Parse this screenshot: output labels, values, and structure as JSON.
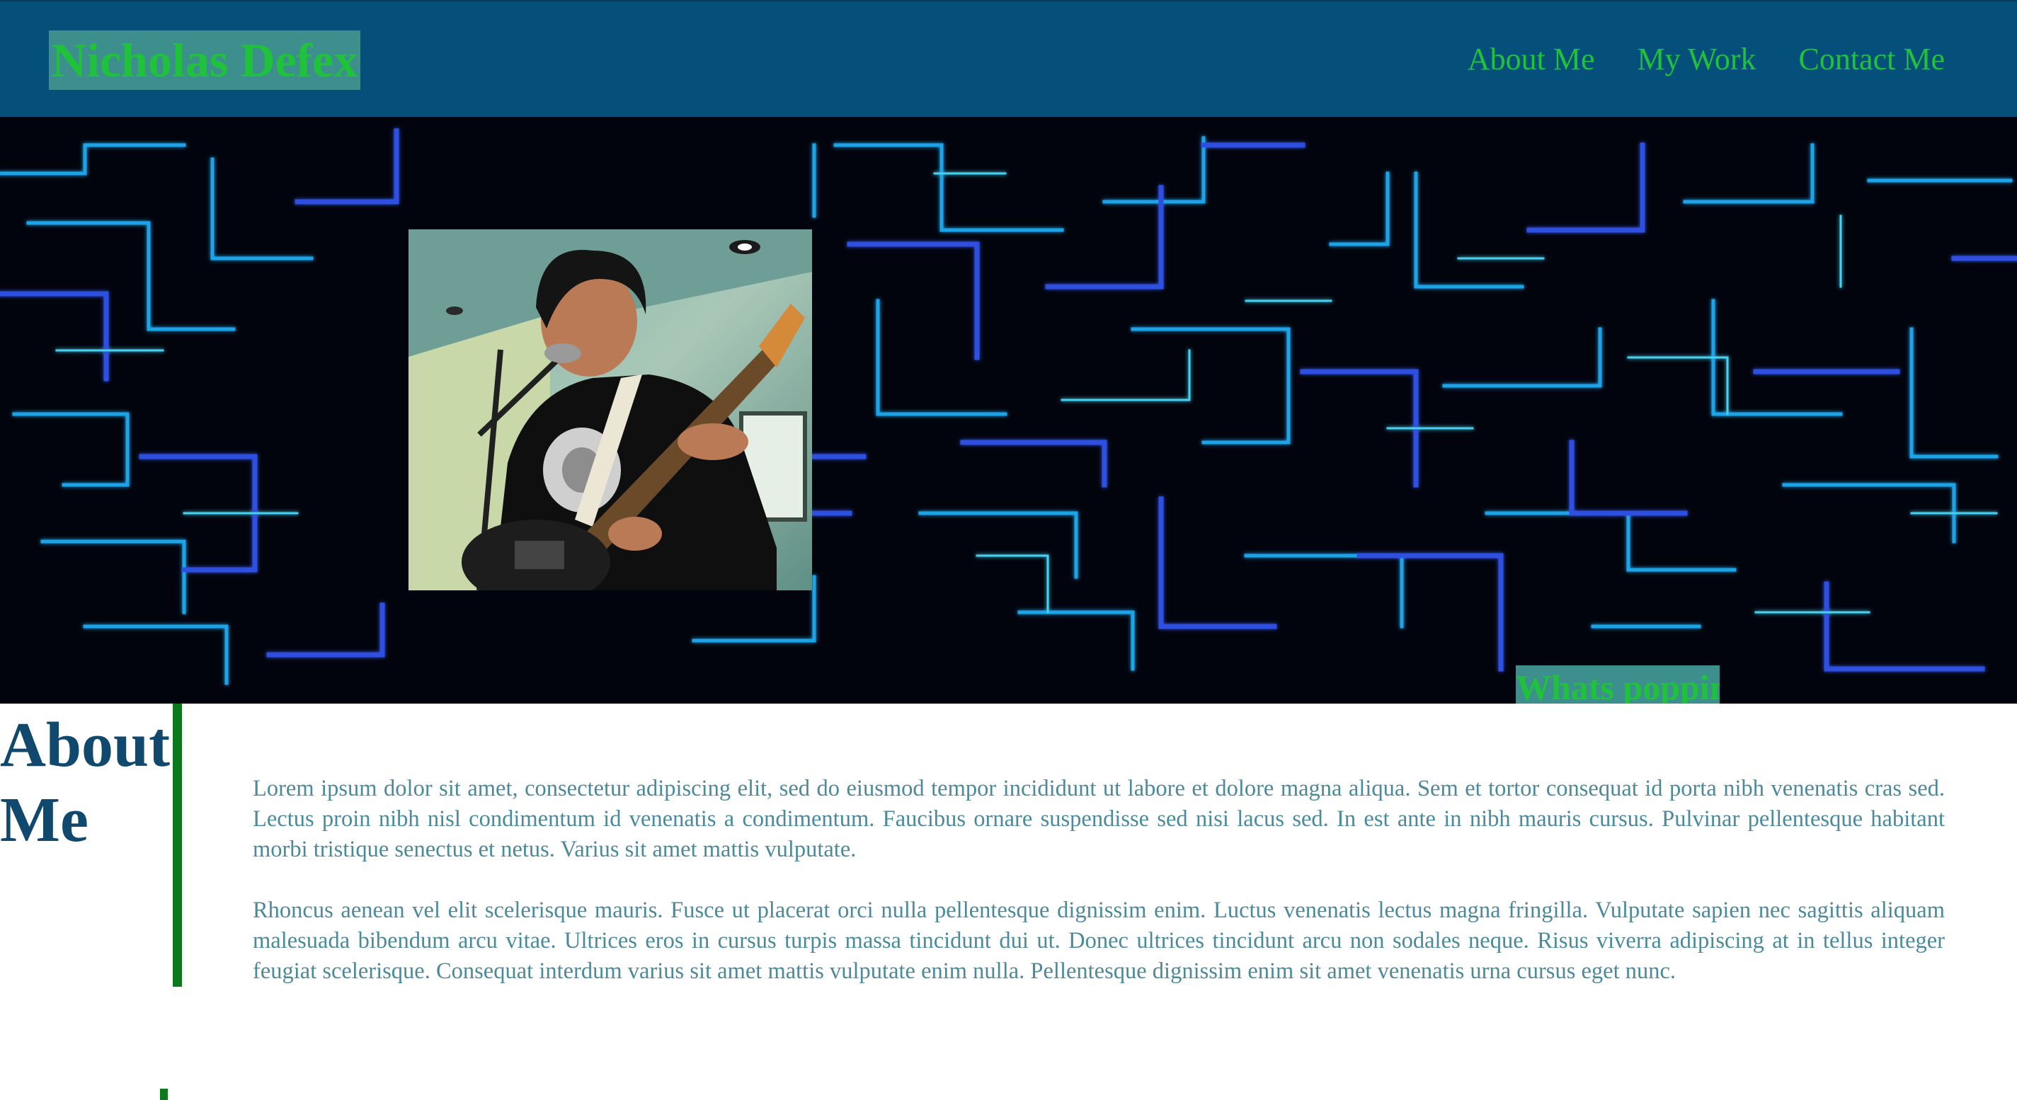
{
  "header": {
    "logo_text": "Nicholas Defex",
    "nav": [
      {
        "label": "About Me"
      },
      {
        "label": "My Work"
      },
      {
        "label": "Contact Me"
      }
    ]
  },
  "hero": {
    "background_icon": "circuit-lines-image",
    "portrait_icon": "guitarist-photo",
    "tagline": "Whats poppin"
  },
  "about": {
    "title": "About Me",
    "paragraphs": [
      "Lorem ipsum dolor sit amet, consectetur adipiscing elit, sed do eiusmod tempor incididunt ut labore et dolore magna aliqua. Sem et tortor consequat id porta nibh venenatis cras sed. Lectus proin nibh nisl condimentum id venenatis a condimentum. Faucibus ornare suspendisse sed nisi lacus sed. In est ante in nibh mauris cursus. Pulvinar pellentesque habitant morbi tristique senectus et netus. Varius sit amet mattis vulputate.",
      "Rhoncus aenean vel elit scelerisque mauris. Fusce ut placerat orci nulla pellentesque dignissim enim. Luctus venenatis lectus magna fringilla. Vulputate sapien nec sagittis aliquam malesuada bibendum arcu vitae. Ultrices eros in cursus turpis massa tincidunt dui ut. Donec ultrices tincidunt arcu non sodales neque. Risus viverra adipiscing at in tellus integer feugiat scelerisque. Consequat interdum varius sit amet mattis vulputate enim nulla. Pellentesque dignissim enim sit amet venenatis urna cursus eget nunc."
    ]
  },
  "colors": {
    "header_bg": "#05507a",
    "accent_green": "#1fc23a",
    "highlight_teal": "#3d8f8e",
    "heading_blue": "#11496e",
    "body_text": "#4a8a9a",
    "rule_green": "#0c7a1c"
  }
}
